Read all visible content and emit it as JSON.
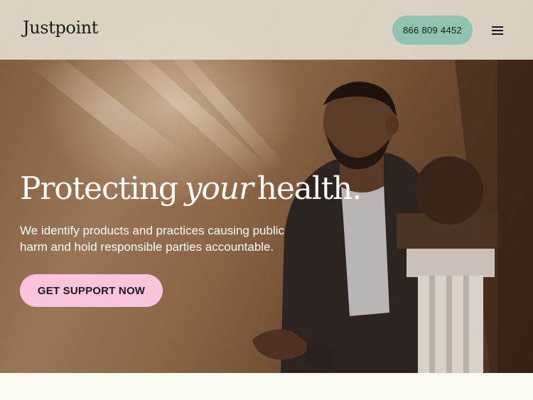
{
  "header": {
    "logo": "Justpoint",
    "phone_label": "866 809 4452"
  },
  "hero": {
    "headline_start": "Protecting",
    "headline_emphasis": "your",
    "headline_end": "health.",
    "subtext": "We identify products and practices causing public harm and hold responsible parties accountable.",
    "cta_label": "GET SUPPORT NOW"
  },
  "colors": {
    "phone_button": "#8fc2af",
    "cta_button": "#f9c4dc",
    "header_bg": "#e2dacc",
    "page_bg": "#fbfaf2"
  },
  "icons": {
    "menu": "hamburger-menu-icon"
  }
}
